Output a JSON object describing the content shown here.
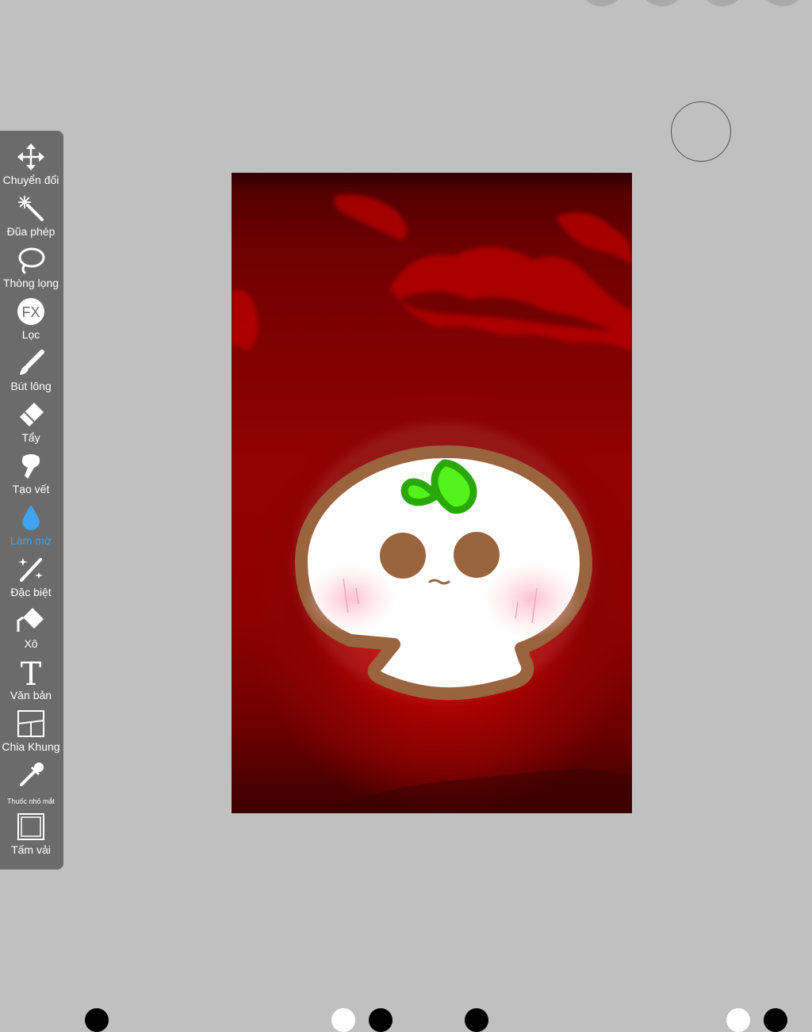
{
  "toolbar": {
    "tools": [
      {
        "label": "Chuyển đổi",
        "icon": "move-icon"
      },
      {
        "label": "Đũa phép",
        "icon": "magic-wand-icon"
      },
      {
        "label": "Thòng lọng",
        "icon": "lasso-icon"
      },
      {
        "label": "Lọc",
        "icon": "fx-icon",
        "icon_text": "FX"
      },
      {
        "label": "Bút lông",
        "icon": "brush-icon"
      },
      {
        "label": "Tẩy",
        "icon": "eraser-icon"
      },
      {
        "label": "Tạo vết",
        "icon": "smudge-icon"
      },
      {
        "label": "Làm mờ",
        "icon": "blur-drop-icon",
        "active": true
      },
      {
        "label": "Đặc biệt",
        "icon": "special-brush-icon"
      },
      {
        "label": "Xô",
        "icon": "bucket-icon"
      },
      {
        "label": "Văn bản",
        "icon": "text-icon",
        "icon_text": "T"
      },
      {
        "label": "Chia Khung",
        "icon": "frame-divider-icon"
      },
      {
        "label": "Thuốc nhỏ mắt",
        "icon": "eyedropper-icon"
      },
      {
        "label": "Tấm vải",
        "icon": "canvas-icon"
      }
    ]
  },
  "colors": {
    "background": "#c0c0c0",
    "toolbar": "#6b6b6b",
    "active_tool": "#3ea4f0",
    "canvas_red": "#c00000",
    "character_outline": "#9a643f",
    "leaf_green": "#3ed018"
  }
}
